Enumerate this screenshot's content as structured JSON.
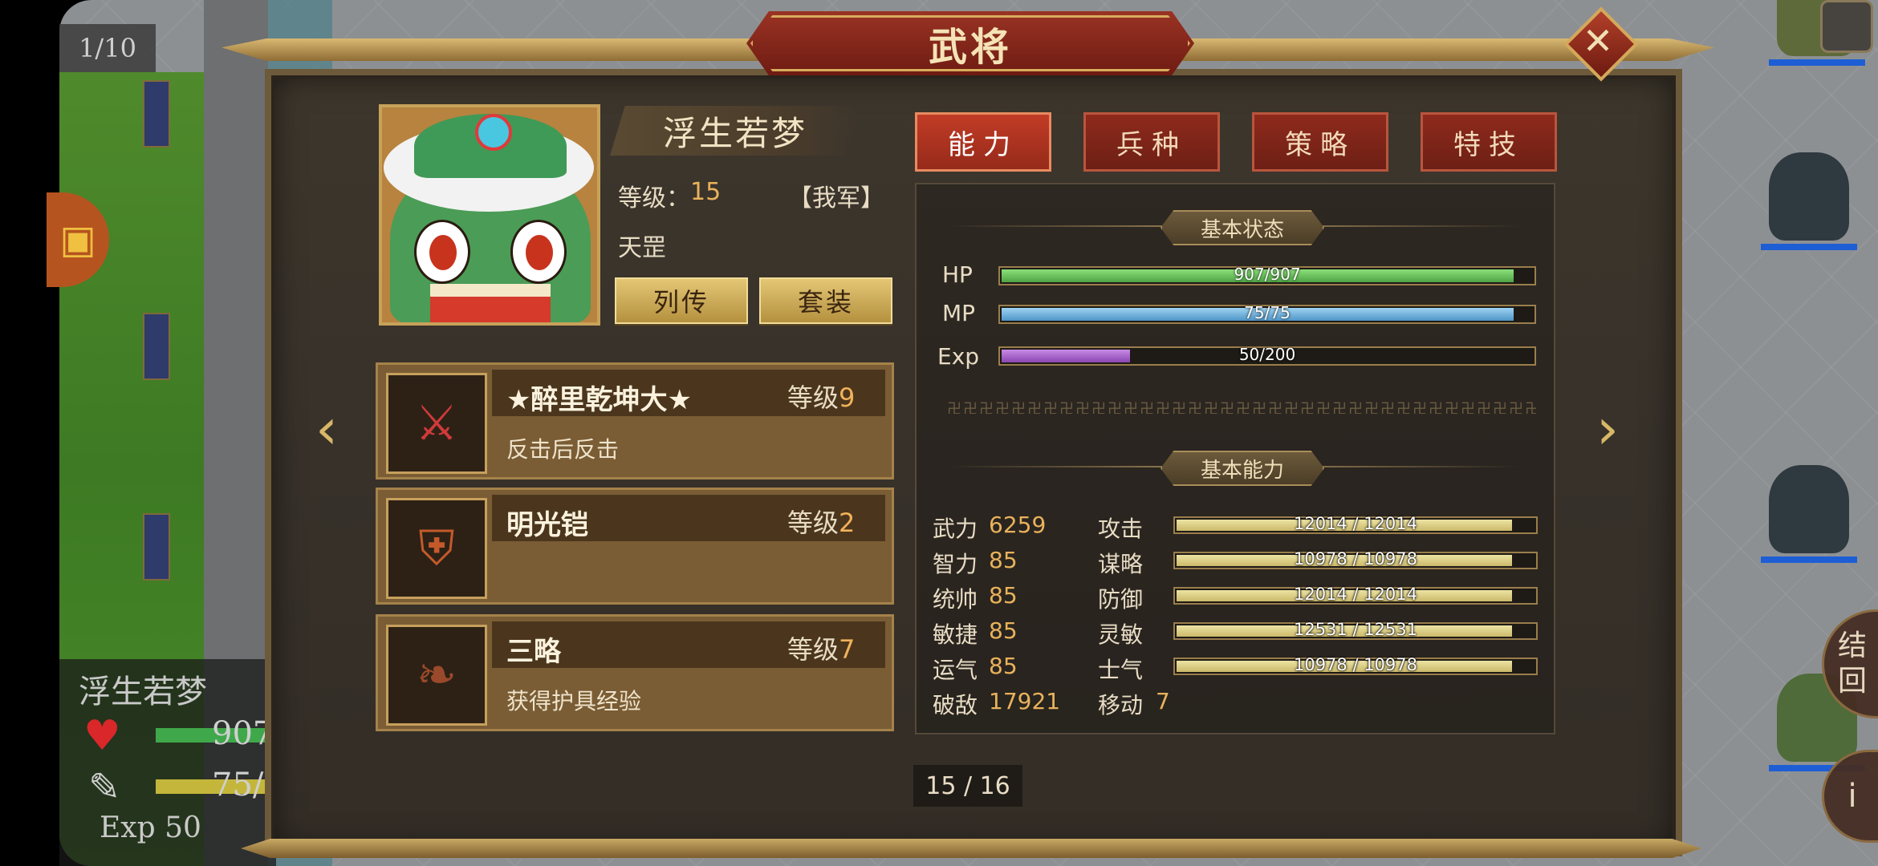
{
  "background": {
    "turn_counter": "1/10",
    "hud": {
      "name": "浮生若梦",
      "hp_value": "907",
      "mp_value": "75/",
      "exp_text": "Exp 50"
    },
    "right_edge_buttons": [
      "结\n回",
      "i"
    ]
  },
  "header": {
    "title": "武将"
  },
  "general": {
    "name": "浮生若梦",
    "level_label": "等级：",
    "level_value": "15",
    "faction": "【我军】",
    "title": "天罡",
    "buttons": {
      "biography": "列传",
      "gear_set": "套装"
    }
  },
  "equipment": [
    {
      "name": "★醉里乾坤大★",
      "level_label": "等级",
      "level": "9",
      "description": "反击后反击",
      "icon": "weapon-icon"
    },
    {
      "name": "明光铠",
      "level_label": "等级",
      "level": "2",
      "description": "",
      "icon": "armor-icon"
    },
    {
      "name": "三略",
      "level_label": "等级",
      "level": "7",
      "description": "获得护具经验",
      "icon": "scroll-icon"
    }
  ],
  "tabs": [
    "能力",
    "兵种",
    "策略",
    "特技"
  ],
  "active_tab": 0,
  "status": {
    "section_title": "基本状态",
    "hp": {
      "label": "HP",
      "text": "907/907",
      "fraction": 1.0
    },
    "mp": {
      "label": "MP",
      "text": "75/75",
      "fraction": 1.0
    },
    "exp": {
      "label": "Exp",
      "text": "50/200",
      "fraction": 0.25
    }
  },
  "abilities": {
    "section_title": "基本能力",
    "attributes": [
      {
        "name": "武力",
        "value": "6259"
      },
      {
        "name": "智力",
        "value": "85"
      },
      {
        "name": "统帅",
        "value": "85"
      },
      {
        "name": "敏捷",
        "value": "85"
      },
      {
        "name": "运气",
        "value": "85"
      },
      {
        "name": "破敌",
        "value": "17921"
      }
    ],
    "combat": [
      {
        "name": "攻击",
        "text": "12014 / 12014"
      },
      {
        "name": "谋略",
        "text": "10978 / 10978"
      },
      {
        "name": "防御",
        "text": "12014 / 12014"
      },
      {
        "name": "灵敏",
        "text": "12531 / 12531"
      },
      {
        "name": "士气",
        "text": "10978 / 10978"
      }
    ],
    "move": {
      "name": "移动",
      "value": "7"
    }
  },
  "pager": "15 / 16",
  "colors": {
    "hp": "#6fc25e",
    "mp": "#6aaed6",
    "exp": "#a35fc7",
    "accent_gold": "#e9b25b",
    "tab_red": "#962a1a"
  }
}
